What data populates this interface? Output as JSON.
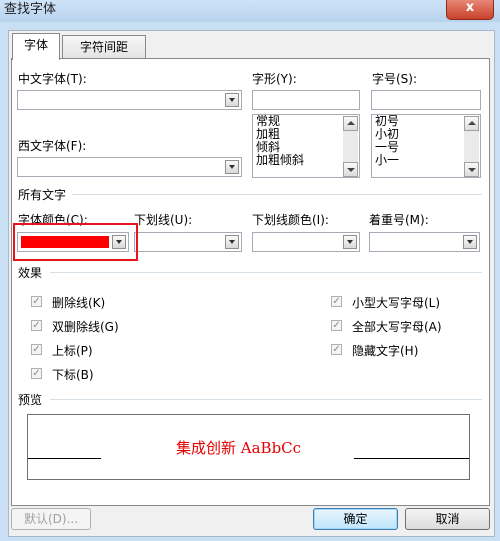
{
  "window": {
    "title": "查找字体",
    "close_label": "x"
  },
  "tabs": [
    {
      "label": "字体",
      "active": true
    },
    {
      "label": "字符间距",
      "active": false
    }
  ],
  "font_section": {
    "chinese_font_label": "中文字体(T):",
    "western_font_label": "西文字体(F):",
    "style_label": "字形(Y):",
    "style_options": [
      "常规",
      "加粗",
      "倾斜",
      "加粗倾斜"
    ],
    "size_label": "字号(S):",
    "size_options": [
      "初号",
      "小初",
      "一号",
      "小一"
    ]
  },
  "all_text": {
    "group_label": "所有文字",
    "font_color_label": "字体颜色(C):",
    "font_color_value": "#ff0000",
    "underline_label": "下划线(U):",
    "underline_color_label": "下划线颜色(I):",
    "emphasis_label": "着重号(M):"
  },
  "effects": {
    "group_label": "效果",
    "strikethrough": "删除线(K)",
    "double_strikethrough": "双删除线(G)",
    "superscript": "上标(P)",
    "subscript": "下标(B)",
    "small_caps": "小型大写字母(L)",
    "all_caps": "全部大写字母(A)",
    "hidden": "隐藏文字(H)",
    "check_mark": "✓"
  },
  "preview": {
    "group_label": "预览",
    "sample_text": "集成创新 AaBbCc",
    "sample_color": "#e60000"
  },
  "buttons": {
    "default": "默认(D)...",
    "ok": "确定",
    "cancel": "取消"
  },
  "highlight_color": "#e8141b"
}
